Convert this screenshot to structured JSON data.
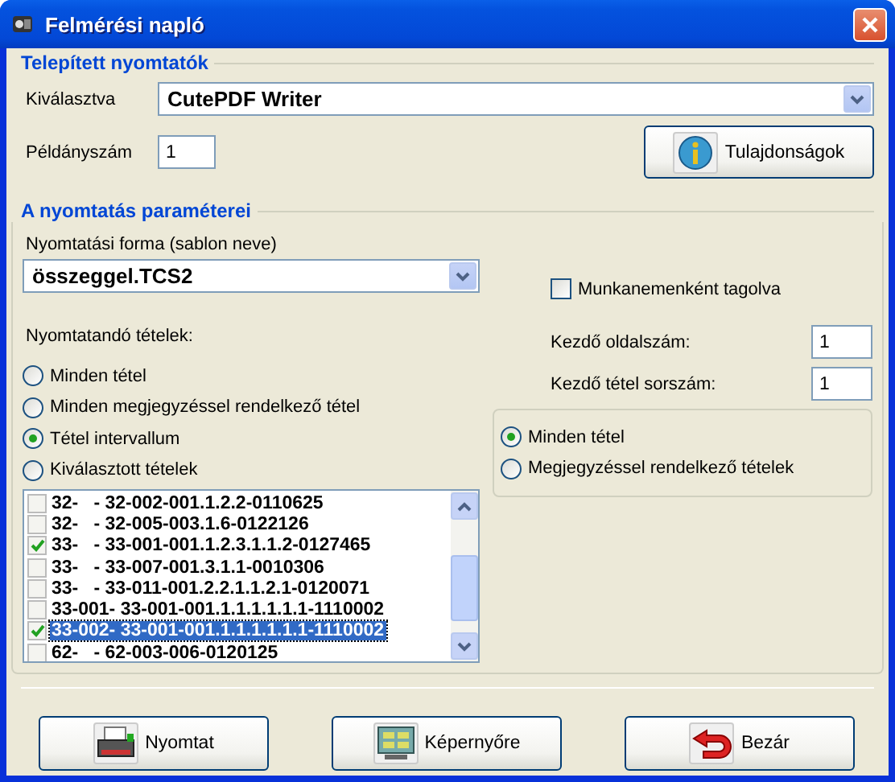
{
  "window": {
    "title": "Felmérési napló"
  },
  "printers": {
    "heading": "Telepített nyomtatók",
    "selected_label": "Kiválasztva",
    "selected_value": "CutePDF Writer",
    "copies_label": "Példányszám",
    "copies_value": "1",
    "properties_button": "Tulajdonságok"
  },
  "parameters": {
    "heading": "A nyomtatás paraméterei",
    "template_label": "Nyomtatási forma (sablon neve)",
    "template_value": "összeggel.TCS2",
    "split_checkbox": {
      "label": "Munkanemenként tagolva",
      "checked": false
    },
    "items_label": "Nyomtatandó tételek:",
    "item_options": [
      {
        "label": "Minden tétel",
        "selected": false
      },
      {
        "label": "Minden megjegyzéssel rendelkező tétel",
        "selected": false
      },
      {
        "label": "Tétel intervallum",
        "selected": true
      },
      {
        "label": "Kiválasztott tételek",
        "selected": false
      }
    ],
    "start_page": {
      "label": "Kezdő oldalszám:",
      "value": "1"
    },
    "start_item": {
      "label": "Kezdő tétel sorszám:",
      "value": "1"
    },
    "filter_options": [
      {
        "label": "Minden tétel",
        "selected": true
      },
      {
        "label": "Megjegyzéssel rendelkező tételek",
        "selected": false
      }
    ],
    "item_list": [
      {
        "text": "32-   - 32-002-001.1.2.2-0110625",
        "checked": false,
        "selected": false
      },
      {
        "text": "32-   - 32-005-003.1.6-0122126",
        "checked": false,
        "selected": false
      },
      {
        "text": "33-   - 33-001-001.1.2.3.1.1.2-0127465",
        "checked": true,
        "selected": false
      },
      {
        "text": "33-   - 33-007-001.3.1.1-0010306",
        "checked": false,
        "selected": false
      },
      {
        "text": "33-   - 33-011-001.2.2.1.1.2.1-0120071",
        "checked": false,
        "selected": false
      },
      {
        "text": "33-001- 33-001-001.1.1.1.1.1.1-1110002",
        "checked": false,
        "selected": false
      },
      {
        "text": "33-002- 33-001-001.1.1.1.1.1.1-1110002",
        "checked": true,
        "selected": true
      },
      {
        "text": "62-   - 62-003-006-0120125",
        "checked": false,
        "selected": false
      }
    ]
  },
  "buttons": [
    {
      "label": "Nyomtat",
      "kind": "print"
    },
    {
      "label": "Képernyőre",
      "kind": "screen"
    },
    {
      "label": "Bezár",
      "kind": "close"
    }
  ]
}
